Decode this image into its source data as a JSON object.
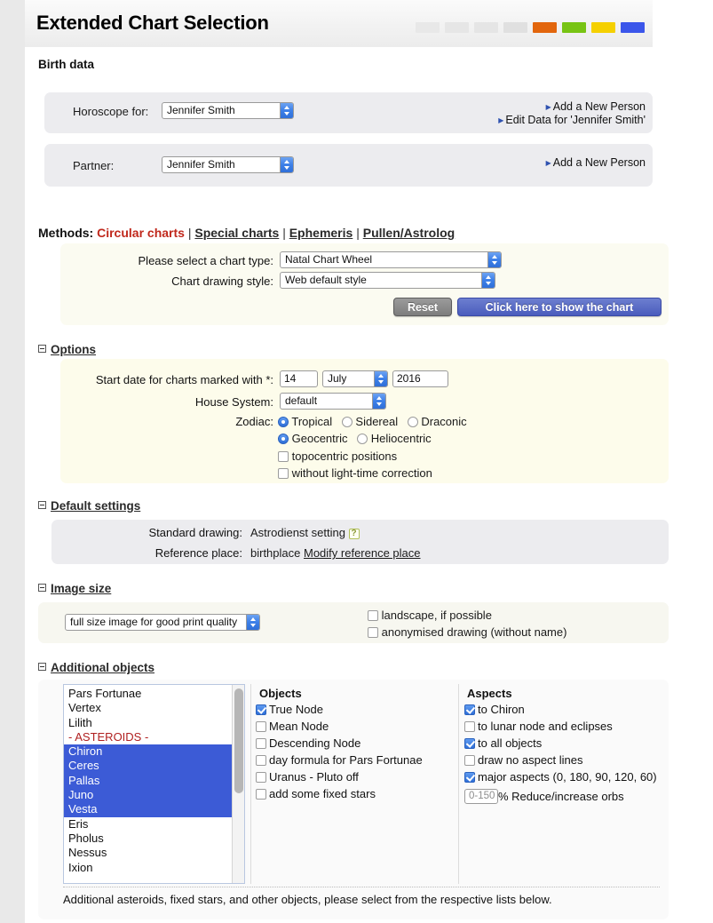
{
  "header": {
    "title": "Extended Chart Selection",
    "color_bars": [
      {
        "name": "bar-grey-1",
        "color": "#e8e8e8"
      },
      {
        "name": "bar-grey-2",
        "color": "#e6e6e6"
      },
      {
        "name": "bar-grey-3",
        "color": "#e5e5e5"
      },
      {
        "name": "bar-grey-4",
        "color": "#e0e0e0"
      },
      {
        "name": "bar-orange",
        "color": "#e2660d"
      },
      {
        "name": "bar-green",
        "color": "#78c414"
      },
      {
        "name": "bar-yellow",
        "color": "#f5d000"
      },
      {
        "name": "bar-blue",
        "color": "#3b56ea"
      }
    ]
  },
  "birth_data": {
    "heading": "Birth data",
    "horoscope": {
      "label": "Horoscope for:",
      "selected": "Jennifer Smith",
      "links": [
        "Add a New Person",
        "Edit Data for 'Jennifer Smith'"
      ]
    },
    "partner": {
      "label": "Partner:",
      "selected": "Jennifer Smith",
      "links": [
        "Add a New Person"
      ]
    }
  },
  "methods": {
    "label": "Methods:",
    "items": [
      {
        "label": "Circular charts",
        "active": true
      },
      {
        "label": "Special charts",
        "active": false
      },
      {
        "label": "Ephemeris",
        "active": false
      },
      {
        "label": "Pullen/Astrolog",
        "active": false
      }
    ],
    "separator": "|",
    "chart_type": {
      "label": "Please select a chart type:",
      "selected": "Natal Chart Wheel"
    },
    "drawing_style": {
      "label": "Chart drawing style:",
      "selected": "Web default style"
    },
    "reset_label": "Reset",
    "submit_label": "Click here to show the chart"
  },
  "options": {
    "heading": "Options",
    "start_date": {
      "label": "Start date for charts marked with *:",
      "day": "14",
      "month": "July",
      "year": "2016"
    },
    "house_system": {
      "label": "House System:",
      "selected": "default"
    },
    "zodiac": {
      "label": "Zodiac:",
      "row1": [
        {
          "label": "Tropical",
          "checked": true
        },
        {
          "label": "Sidereal",
          "checked": false
        },
        {
          "label": "Draconic",
          "checked": false
        }
      ],
      "row2": [
        {
          "label": "Geocentric",
          "checked": true
        },
        {
          "label": "Heliocentric",
          "checked": false
        }
      ],
      "checkboxes": [
        {
          "label": "topocentric positions",
          "checked": false
        },
        {
          "label": "without light-time correction",
          "checked": false
        }
      ]
    }
  },
  "default_settings": {
    "heading": "Default settings",
    "standard_drawing": {
      "label": "Standard drawing:",
      "value": "Astrodienst setting",
      "help": "?"
    },
    "reference_place": {
      "label": "Reference place:",
      "value": "birthplace",
      "link": "Modify reference place"
    }
  },
  "image_size": {
    "heading": "Image size",
    "selected": "full size image for good print quality",
    "checkboxes": [
      {
        "label": "landscape, if possible",
        "checked": false
      },
      {
        "label": "anonymised drawing (without name)",
        "checked": false
      }
    ]
  },
  "additional_objects": {
    "heading": "Additional objects",
    "listbox": [
      {
        "label": "Pars Fortunae",
        "selected": false,
        "style": "normal"
      },
      {
        "label": "Vertex",
        "selected": false,
        "style": "normal"
      },
      {
        "label": "Lilith",
        "selected": false,
        "style": "normal"
      },
      {
        "label": "- ASTEROIDS -",
        "selected": false,
        "style": "red"
      },
      {
        "label": "Chiron",
        "selected": true,
        "style": "normal"
      },
      {
        "label": "Ceres",
        "selected": true,
        "style": "normal"
      },
      {
        "label": "Pallas",
        "selected": true,
        "style": "normal"
      },
      {
        "label": "Juno",
        "selected": true,
        "style": "normal"
      },
      {
        "label": "Vesta",
        "selected": true,
        "style": "normal"
      },
      {
        "label": "Eris",
        "selected": false,
        "style": "normal"
      },
      {
        "label": "Pholus",
        "selected": false,
        "style": "normal"
      },
      {
        "label": "Nessus",
        "selected": false,
        "style": "normal"
      },
      {
        "label": "Ixion",
        "selected": false,
        "style": "normal"
      }
    ],
    "objects": {
      "heading": "Objects",
      "items": [
        {
          "label": "True Node",
          "checked": true
        },
        {
          "label": "Mean Node",
          "checked": false
        },
        {
          "label": "Descending Node",
          "checked": false
        },
        {
          "label": "day formula for Pars Fortunae",
          "checked": false
        },
        {
          "label": "Uranus - Pluto off",
          "checked": false
        },
        {
          "label": "add some fixed stars",
          "checked": false
        }
      ]
    },
    "aspects": {
      "heading": "Aspects",
      "items": [
        {
          "label": "to Chiron",
          "checked": true
        },
        {
          "label": "to lunar node and eclipses",
          "checked": false
        },
        {
          "label": "to all objects",
          "checked": true
        },
        {
          "label": "draw no aspect lines",
          "checked": false
        },
        {
          "label": "major aspects (0, 180, 90, 120, 60)",
          "checked": true
        }
      ],
      "orb": {
        "placeholder": "0-150",
        "value": "",
        "suffix": "% Reduce/increase orbs"
      }
    },
    "note": "Additional asteroids, fixed stars, and other objects, please select from the respective lists below."
  }
}
